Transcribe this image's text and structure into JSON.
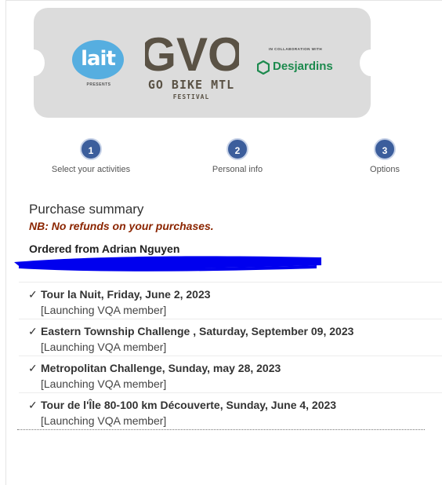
{
  "banner": {
    "lait_text": "lait",
    "presents_text": "PRESENTS",
    "gvo_text": "GVO",
    "gvo_line1": "GO BIKE MTL",
    "gvo_line2": "FESTIVAL",
    "collab_text": "IN COLLABORATION WITH",
    "desjardins_text": "Desjardins"
  },
  "steps": [
    {
      "number": "1",
      "label": "Select your activities"
    },
    {
      "number": "2",
      "label": "Personal info"
    },
    {
      "number": "3",
      "label": "Options"
    }
  ],
  "summary": {
    "title": "Purchase summary",
    "nb": "NB: No refunds on your purchases.",
    "ordered_from": "Ordered from Adrian Nguyen"
  },
  "items": [
    {
      "check": "✓",
      "event": "Tour la Nuit, Friday, June 2, 2023",
      "member": "[Launching VQA member]"
    },
    {
      "check": "✓",
      "event": "Eastern Township Challenge , Saturday, September 09, 2023",
      "member": "[Launching VQA member]"
    },
    {
      "check": "✓",
      "event": "Metropolitan Challenge, Sunday, may 28, 2023",
      "member": "[Launching VQA member]"
    },
    {
      "check": "✓",
      "event": "Tour de l'Île 80-100 km Découverte, Sunday, June 4, 2023",
      "member": "[Launching VQA member]"
    }
  ],
  "colors": {
    "step_circle": "#3c5e9c",
    "nb_text": "#8b2500",
    "redaction": "#0000ee",
    "desjardins_green": "#1d8a4e",
    "lait_blue": "#56aee0"
  },
  "icons": {
    "check": "check-icon",
    "desjardins": "desjardins-hexagon-icon"
  }
}
